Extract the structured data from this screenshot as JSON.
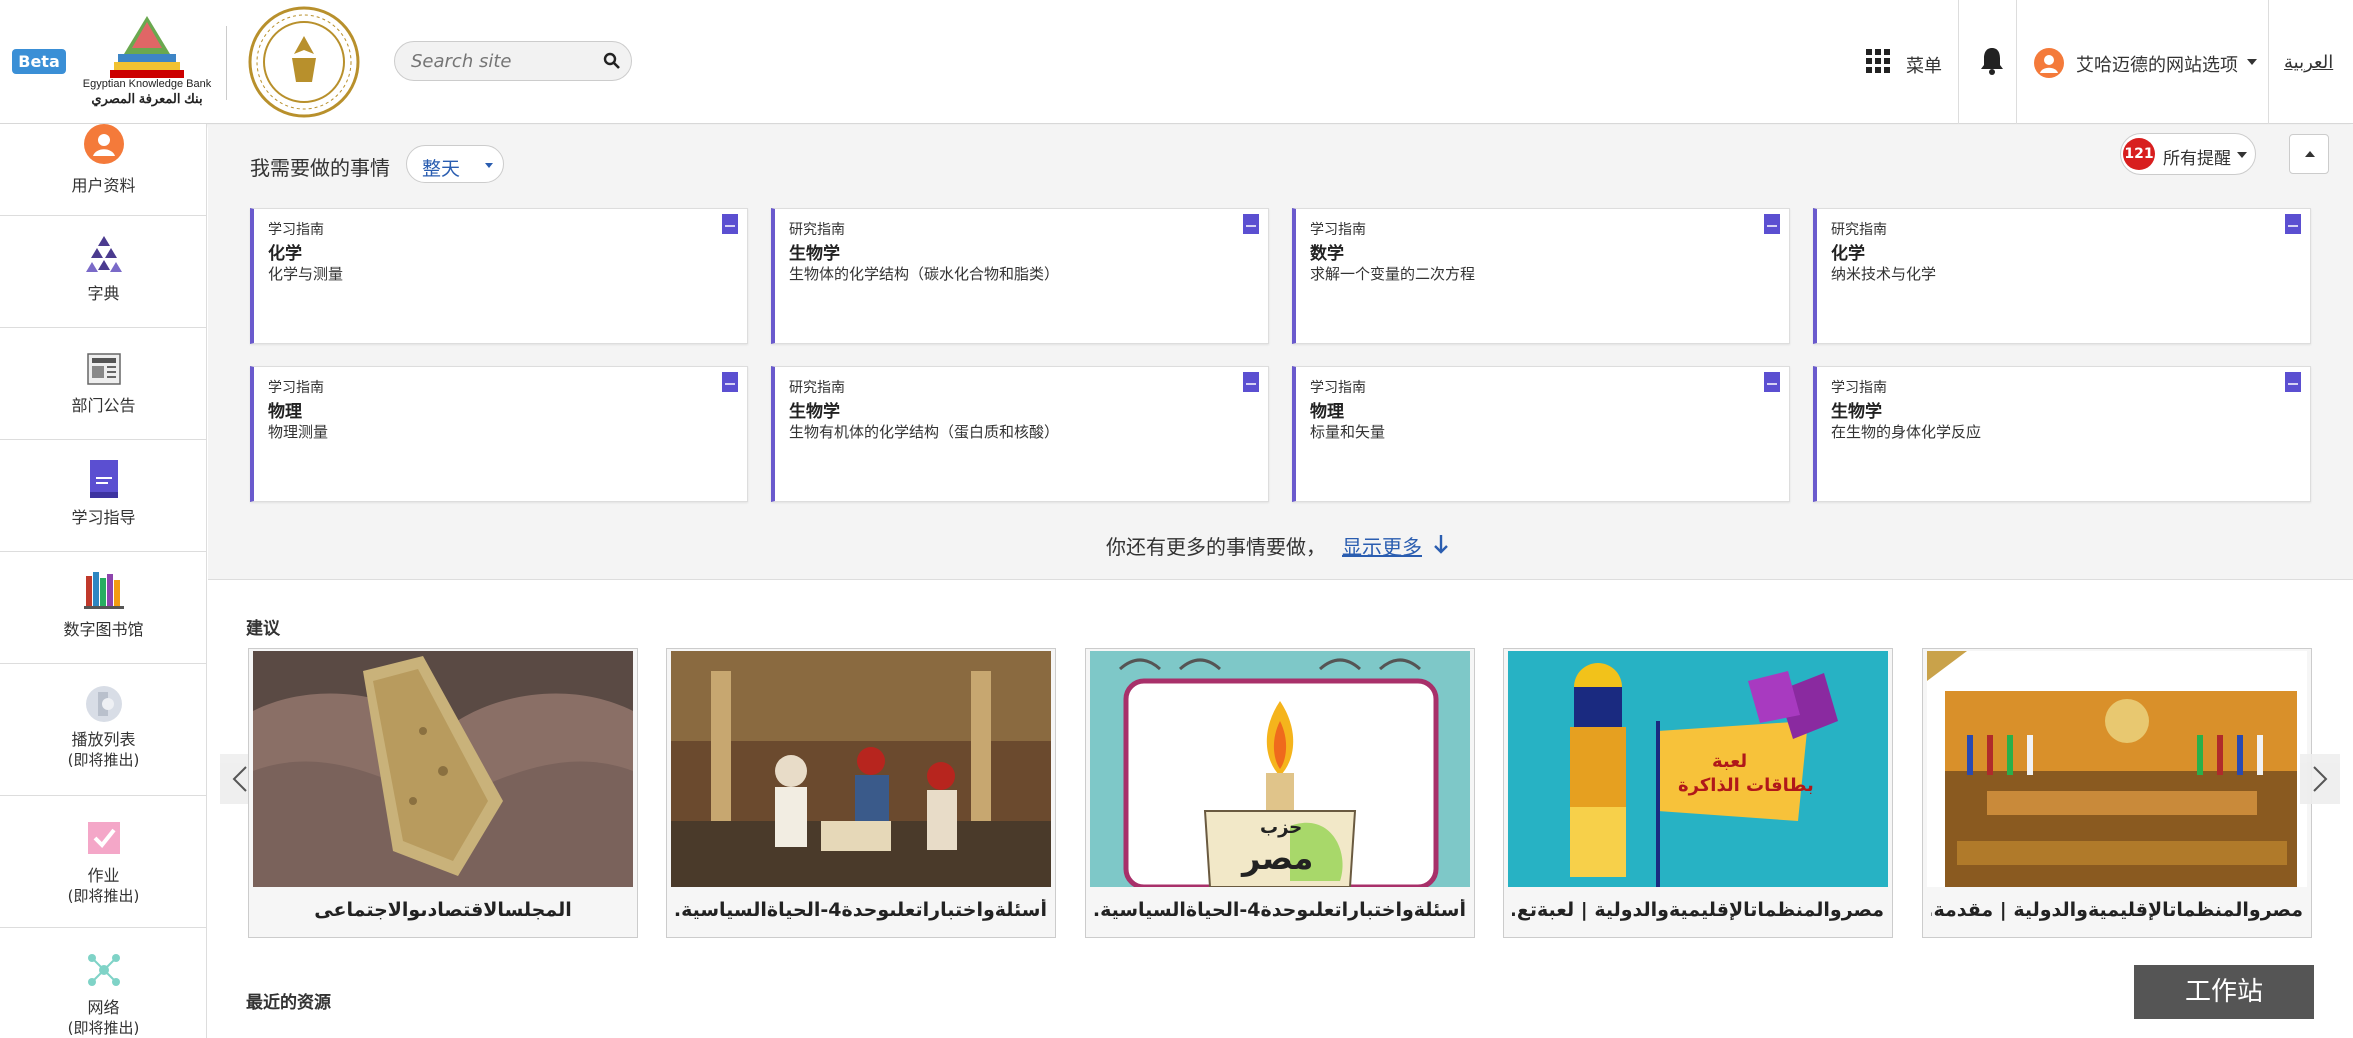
{
  "header": {
    "beta_label": "Beta",
    "ekb_name_en": "Egyptian Knowledge Bank",
    "ekb_name_ar": "بنك المعرفة المصري",
    "search_placeholder": "Search site",
    "menu_label": "菜单",
    "user_label": "艾哈迈德的网站选项",
    "language_link": "العربية"
  },
  "sidebar": {
    "items": [
      {
        "label": "用户资料",
        "icon": "user-profile-icon"
      },
      {
        "label": "字典",
        "icon": "dictionary-icon"
      },
      {
        "label": "部门公告",
        "icon": "announcements-icon"
      },
      {
        "label": "学习指导",
        "icon": "study-guide-icon"
      },
      {
        "label": "数字图书馆",
        "icon": "digital-library-icon"
      },
      {
        "label": "播放列表",
        "sub": "(即将推出)",
        "icon": "playlist-icon"
      },
      {
        "label": "作业",
        "sub": "(即将推出)",
        "icon": "assignment-icon"
      },
      {
        "label": "网络",
        "sub": "(即将推出)",
        "icon": "network-icon"
      }
    ]
  },
  "todo": {
    "title": "我需要做的事情",
    "filter_value": "整天",
    "alerts_count": "121",
    "alerts_label": "所有提醒",
    "more_text": "你还有更多的事情要做，",
    "more_link": "显示更多",
    "cards": [
      {
        "type": "学习指南",
        "subject": "化学",
        "topic": "化学与测量"
      },
      {
        "type": "研究指南",
        "subject": "生物学",
        "topic": "生物体的化学结构（碳水化合物和脂类）"
      },
      {
        "type": "学习指南",
        "subject": "数学",
        "topic": "求解一个变量的二次方程"
      },
      {
        "type": "研究指南",
        "subject": "化学",
        "topic": "纳米技术与化学"
      },
      {
        "type": "学习指南",
        "subject": "物理",
        "topic": "物理测量"
      },
      {
        "type": "研究指南",
        "subject": "生物学",
        "topic": "生物有机体的化学结构（蛋白质和核酸）"
      },
      {
        "type": "学习指南",
        "subject": "物理",
        "topic": "标量和矢量"
      },
      {
        "type": "学习指南",
        "subject": "生物学",
        "topic": "在生物的身体化学反应"
      }
    ]
  },
  "recommendations": {
    "title": "建议",
    "items": [
      {
        "label": "المجلسالاقتصادىوالاجتماعى"
      },
      {
        "label": "أسئلةواختباراتعلىوحدة4-الحياةالسياسية..."
      },
      {
        "label": "أسئلةواختباراتعلىوحدة4-الحياةالسياسية..."
      },
      {
        "label": "مصروالمنظماتالإقليميةوالدولية | لعبةتع..."
      },
      {
        "label": "مصروالمنظماتالإقليميةوالدولية | مقدمة..."
      }
    ],
    "poster_text_1": "حزب",
    "poster_text_2": "مصر",
    "game_text_1": "لعبة",
    "game_text_2": "بطاقات الذاكرة"
  },
  "recent": {
    "title": "最近的资源"
  },
  "workstation_label": "工作站",
  "colors": {
    "accent_blue": "#2a5db0",
    "card_border": "#6a5acd",
    "badge_red": "#d81e1e",
    "avatar_orange": "#f47a3a",
    "beta_blue": "#3a8fd6"
  }
}
